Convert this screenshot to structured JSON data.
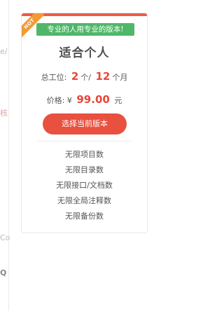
{
  "background_fragments": [
    {
      "text": "e/",
      "color": "#bbbbbb"
    },
    {
      "text": "",
      "color": "#bbbbbb"
    },
    {
      "text": "核",
      "color": "#e4a4a4"
    },
    {
      "text": "",
      "color": "#bbbbbb"
    },
    {
      "text": "Co",
      "color": "#bbbbbb"
    },
    {
      "text": "Q",
      "color": "#888888"
    }
  ],
  "plan": {
    "hot_badge": "HOT",
    "tagline": "专业的人用专业的版本!",
    "title": "适合个人",
    "duration": {
      "label": "总工位:",
      "seats": "2",
      "seats_unit": "个/",
      "months": "12",
      "months_unit": "个月"
    },
    "price": {
      "label": "价格:",
      "currency": "¥",
      "value": "99.00",
      "unit": "元"
    },
    "select_button_label": "选择当前版本",
    "features": [
      "无限项目数",
      "无限目录数",
      "无限接口/文档数",
      "无限全局注释数",
      "无限备份数"
    ]
  },
  "colors": {
    "accent_red": "#e8503f",
    "tagline_green": "#4fb769",
    "hot_orange": "#f39a34"
  }
}
